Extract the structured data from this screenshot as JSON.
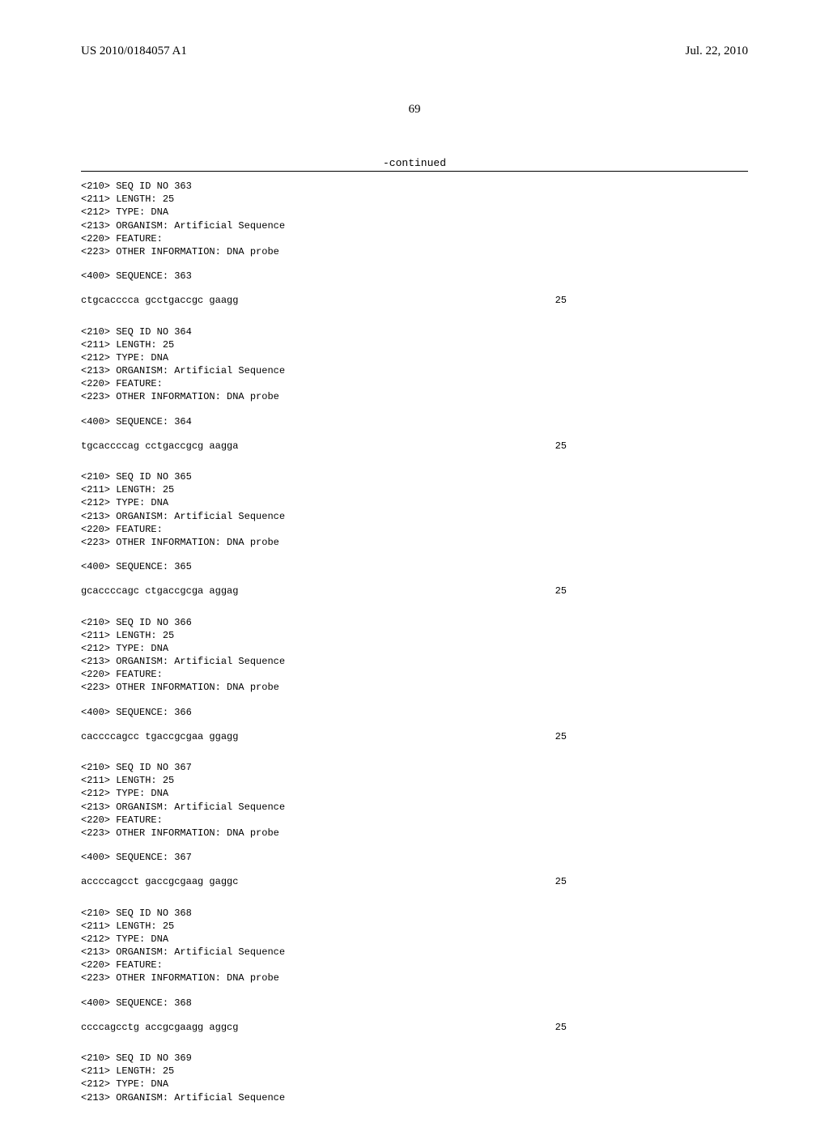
{
  "header": {
    "pub_number": "US 2010/0184057 A1",
    "pub_date": "Jul. 22, 2010"
  },
  "page_number": "69",
  "continued_label": "-continued",
  "entries": [
    {
      "lines": [
        "<210> SEQ ID NO 363",
        "<211> LENGTH: 25",
        "<212> TYPE: DNA",
        "<213> ORGANISM: Artificial Sequence",
        "<220> FEATURE:",
        "<223> OTHER INFORMATION: DNA probe"
      ],
      "seq_header": "<400> SEQUENCE: 363",
      "sequence": "ctgcacccca gcctgaccgc gaagg",
      "length": "25"
    },
    {
      "lines": [
        "<210> SEQ ID NO 364",
        "<211> LENGTH: 25",
        "<212> TYPE: DNA",
        "<213> ORGANISM: Artificial Sequence",
        "<220> FEATURE:",
        "<223> OTHER INFORMATION: DNA probe"
      ],
      "seq_header": "<400> SEQUENCE: 364",
      "sequence": "tgcaccccag cctgaccgcg aagga",
      "length": "25"
    },
    {
      "lines": [
        "<210> SEQ ID NO 365",
        "<211> LENGTH: 25",
        "<212> TYPE: DNA",
        "<213> ORGANISM: Artificial Sequence",
        "<220> FEATURE:",
        "<223> OTHER INFORMATION: DNA probe"
      ],
      "seq_header": "<400> SEQUENCE: 365",
      "sequence": "gcaccccagc ctgaccgcga aggag",
      "length": "25"
    },
    {
      "lines": [
        "<210> SEQ ID NO 366",
        "<211> LENGTH: 25",
        "<212> TYPE: DNA",
        "<213> ORGANISM: Artificial Sequence",
        "<220> FEATURE:",
        "<223> OTHER INFORMATION: DNA probe"
      ],
      "seq_header": "<400> SEQUENCE: 366",
      "sequence": "caccccagcc tgaccgcgaa ggagg",
      "length": "25"
    },
    {
      "lines": [
        "<210> SEQ ID NO 367",
        "<211> LENGTH: 25",
        "<212> TYPE: DNA",
        "<213> ORGANISM: Artificial Sequence",
        "<220> FEATURE:",
        "<223> OTHER INFORMATION: DNA probe"
      ],
      "seq_header": "<400> SEQUENCE: 367",
      "sequence": "accccagcct gaccgcgaag gaggc",
      "length": "25"
    },
    {
      "lines": [
        "<210> SEQ ID NO 368",
        "<211> LENGTH: 25",
        "<212> TYPE: DNA",
        "<213> ORGANISM: Artificial Sequence",
        "<220> FEATURE:",
        "<223> OTHER INFORMATION: DNA probe"
      ],
      "seq_header": "<400> SEQUENCE: 368",
      "sequence": "ccccagcctg accgcgaagg aggcg",
      "length": "25"
    },
    {
      "lines": [
        "<210> SEQ ID NO 369",
        "<211> LENGTH: 25",
        "<212> TYPE: DNA",
        "<213> ORGANISM: Artificial Sequence"
      ],
      "seq_header": null,
      "sequence": null,
      "length": null
    }
  ]
}
